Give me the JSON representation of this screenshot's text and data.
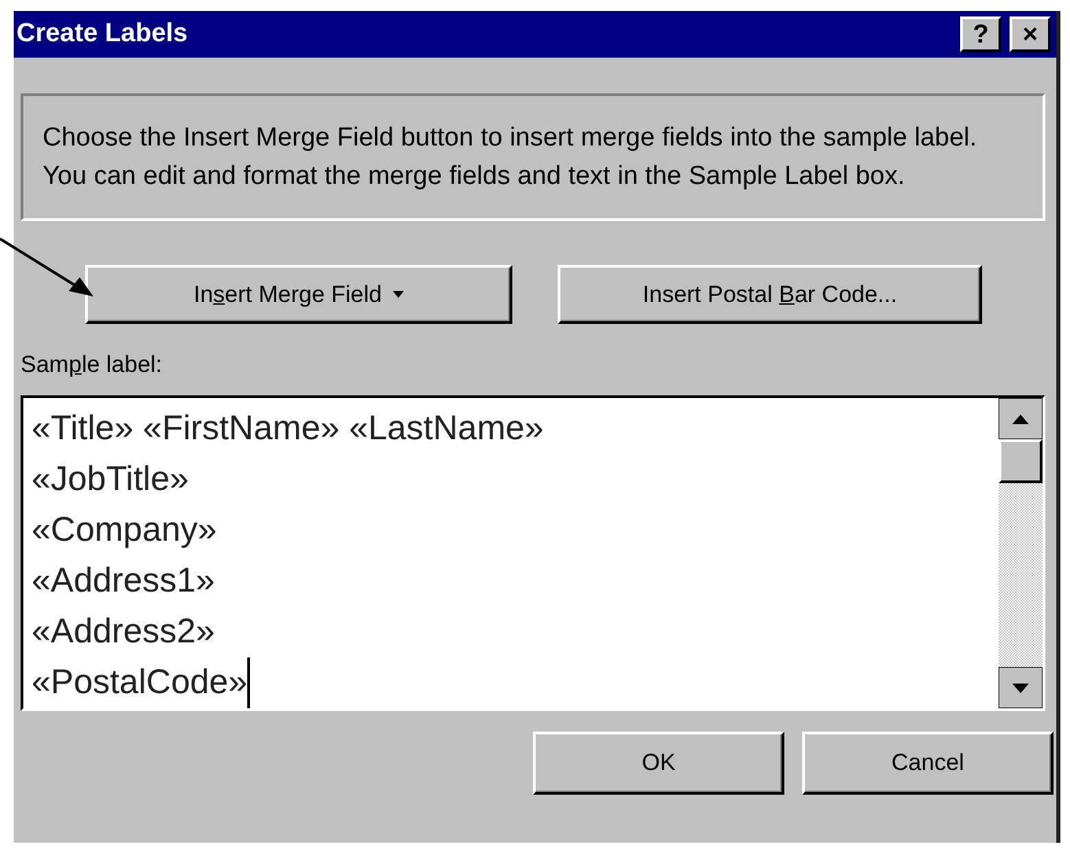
{
  "window": {
    "title": "Create Labels",
    "title_buttons": [
      {
        "label": "?"
      },
      {
        "label": "×"
      }
    ]
  },
  "instructions": "Choose the Insert Merge Field button to insert merge fields into the sample label.  You can edit and format the merge fields and text in the Sample Label box.",
  "field_buttons": [
    {
      "label": {
        "before": "In",
        "access_key": "s",
        "after": "ert Merge Field"
      },
      "dropdown": true
    },
    {
      "label": {
        "before": "Insert Postal ",
        "access_key": "B",
        "after": "ar Code..."
      },
      "dropdown": false
    }
  ],
  "sample_label": {
    "label": {
      "before": "Sam",
      "access_key": "p",
      "after": "le label:"
    },
    "lines": [
      {
        "text": "«Title» «FirstName» «LastName»",
        "cursor": false
      },
      {
        "text": "«JobTitle»",
        "cursor": false
      },
      {
        "text": "«Company»",
        "cursor": false
      },
      {
        "text": "«Address1»",
        "cursor": false
      },
      {
        "text": "«Address2»",
        "cursor": false
      },
      {
        "text": "«PostalCode»",
        "cursor": true
      }
    ]
  },
  "buttons": [
    {
      "label": "OK"
    },
    {
      "label": "Cancel"
    }
  ]
}
